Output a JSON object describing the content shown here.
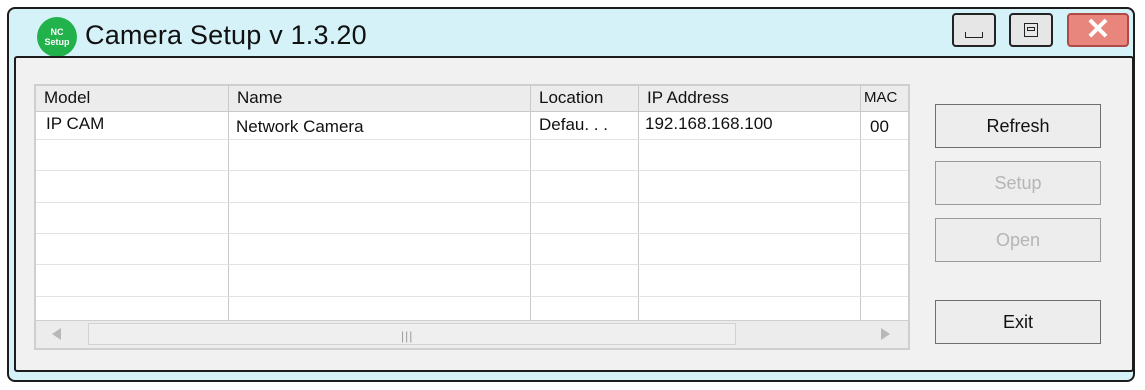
{
  "window": {
    "icon_text_1": "NC",
    "icon_text_2": "Setup",
    "title": "Camera Setup v 1.3.20"
  },
  "table": {
    "columns": [
      "Model",
      "Name",
      "Location",
      "IP Address",
      "MAC"
    ],
    "rows": [
      [
        "IP CAM",
        "Network Camera",
        "Defau. . .",
        "192.168.168.100",
        "00"
      ]
    ]
  },
  "buttons": {
    "refresh": "Refresh",
    "setup": "Setup",
    "open": "Open",
    "exit": "Exit"
  },
  "colors": {
    "title_bar": "#d6f2f9",
    "icon": "#21b24b",
    "close": "#e8857d"
  }
}
